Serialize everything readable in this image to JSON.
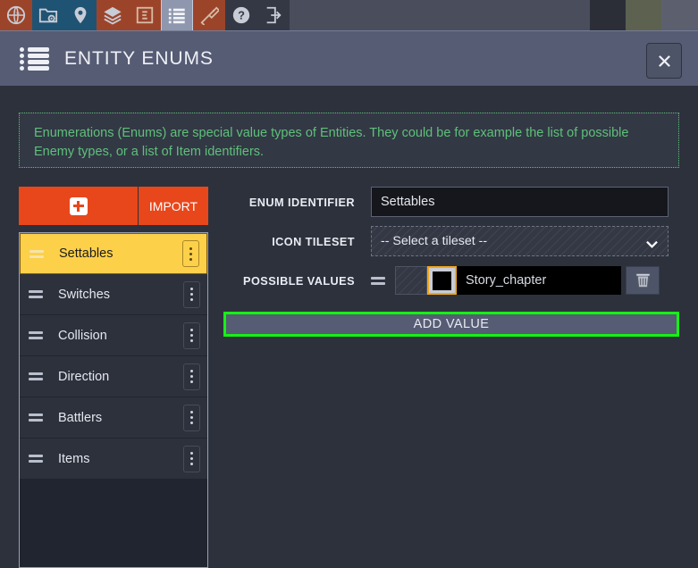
{
  "toolbar": {
    "buttons": [
      {
        "name": "globe-icon",
        "tooltip": "World",
        "style": "brown",
        "active": false
      },
      {
        "name": "folder-gear-icon",
        "tooltip": "Project",
        "style": "blue",
        "active": false
      },
      {
        "name": "map-pin-icon",
        "tooltip": "Location",
        "style": "blue",
        "active": false
      },
      {
        "name": "layers-icon",
        "tooltip": "Layers",
        "style": "brown",
        "active": false
      },
      {
        "name": "entity-icon",
        "tooltip": "Entities",
        "style": "brown",
        "active": false
      },
      {
        "name": "list-icon",
        "tooltip": "Enums",
        "style": "active",
        "active": true
      },
      {
        "name": "paintbrush-icon",
        "tooltip": "Paint",
        "style": "brown",
        "active": false
      },
      {
        "name": "help-icon",
        "tooltip": "Help",
        "style": "dark",
        "active": false
      },
      {
        "name": "exit-icon",
        "tooltip": "Exit",
        "style": "dark",
        "active": false
      }
    ]
  },
  "header": {
    "title": "ENTITY ENUMS",
    "close_label": "✕"
  },
  "info": {
    "text": "Enumerations (Enums) are special value types of Entities. They could be for example the list of possible Enemy types, or a list of Item identifiers."
  },
  "sidebar": {
    "add_label": "+",
    "import_label": "IMPORT",
    "items": [
      {
        "label": "Settables",
        "selected": true
      },
      {
        "label": "Switches",
        "selected": false
      },
      {
        "label": "Collision",
        "selected": false
      },
      {
        "label": "Direction",
        "selected": false
      },
      {
        "label": "Battlers",
        "selected": false
      },
      {
        "label": "Items",
        "selected": false
      }
    ]
  },
  "form": {
    "identifier_label": "ENUM IDENTIFIER",
    "identifier_value": "Settables",
    "tileset_label": "ICON TILESET",
    "tileset_value": "-- Select a tileset --",
    "values_label": "POSSIBLE VALUES",
    "value_entry": "Story_chapter",
    "value_color": "#000000",
    "add_value_label": "ADD VALUE"
  },
  "colors": {
    "accent_orange": "#e8471b",
    "selected_yellow": "#fdd04a",
    "info_green": "#5ec07a",
    "focus_green": "#14f214",
    "swatch_border": "#f0a61c",
    "panel_bg": "#2d313c",
    "header_bg": "#565c74"
  }
}
